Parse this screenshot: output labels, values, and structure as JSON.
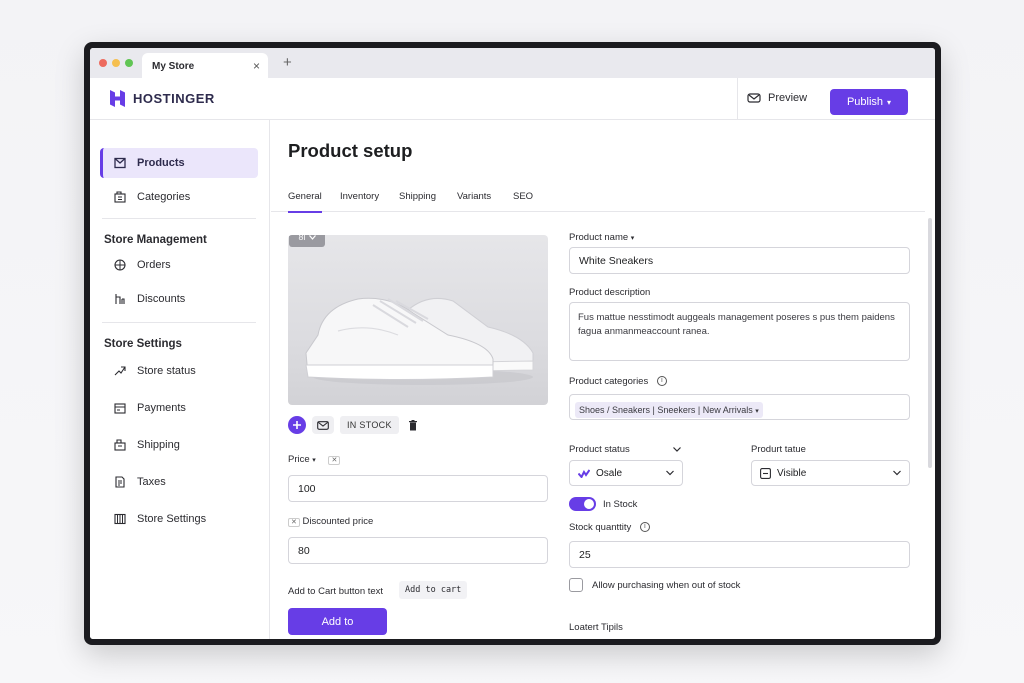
{
  "browser": {
    "tab_title": "My Store",
    "tab_close": "×",
    "new_tab": "+",
    "dots": [
      "#ed6a5e",
      "#f5bf4f",
      "#61c554"
    ]
  },
  "header": {
    "logo_text": "HOSTINGER",
    "preview_label": "Preview",
    "publish_label": "Publish",
    "publish_caret": "▾"
  },
  "sidebar": {
    "items_top": [
      {
        "label": "Products",
        "icon": "box-icon",
        "active": true
      },
      {
        "label": "Categories",
        "icon": "categories-icon",
        "active": false
      }
    ],
    "store_management": {
      "title": "Store Management",
      "items": [
        {
          "label": "Orders",
          "icon": "orders-icon"
        },
        {
          "label": "Discounts",
          "icon": "discounts-icon"
        }
      ]
    },
    "store_settings": {
      "title": "Store Settings",
      "items": [
        {
          "label": "Store status",
          "icon": "store-status-icon"
        },
        {
          "label": "Payments",
          "icon": "payments-icon"
        },
        {
          "label": "Shipping",
          "icon": "shipping-icon"
        },
        {
          "label": "Taxes",
          "icon": "taxes-icon"
        },
        {
          "label": "Store Settings",
          "icon": "store-settings-icon"
        }
      ]
    }
  },
  "main": {
    "page_title": "Product setup",
    "tabs": [
      "General",
      "Inventory",
      "Shipping",
      "Variants",
      "SEO"
    ],
    "active_tab": "General",
    "image_badge": "ȢI",
    "stock_pill": "IN STOCK",
    "price_label": "Price",
    "price_value": "100",
    "discounted_price_label": "Discounted price",
    "discounted_price_value": "80",
    "add_to_cart_label": "Add to Cart button text",
    "add_to_cart_value": "Add to cart",
    "add_to_button": "Add to",
    "product_name_label": "Product name",
    "product_name_value": "White Sneakers",
    "product_description_label": "Product description",
    "product_description_value": "Fus mattue nesstimodt auggeals management poseres s pus them paidens fagua anmanmeaccount ranea.",
    "product_categories_label": "Product categories",
    "product_categories_value": "Shoes / Sneakers | Sneekers | New Arrivals",
    "product_status_label": "Product status",
    "product_status_value": "Osale",
    "produrt_tatue_label": "Produrt tatue",
    "produrt_tatue_value": "Visible",
    "in_stock_label": "In Stock",
    "in_stock_on": true,
    "stock_quantity_label": "Stock quanttity",
    "stock_quantity_value": "25",
    "allow_purchasing_label": "Allow purchasing when out of stock",
    "allow_purchasing_checked": false,
    "loatert_tipils_label": "Loatert Tipils"
  },
  "colors": {
    "accent": "#673de6",
    "active_bg": "#ebe6fb"
  }
}
